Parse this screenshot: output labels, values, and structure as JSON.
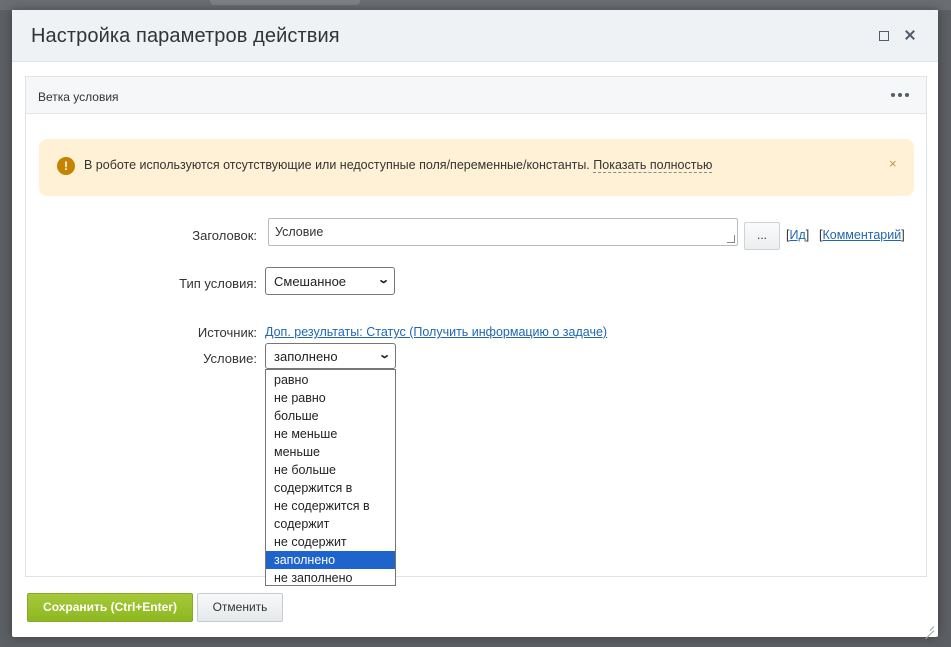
{
  "dialog": {
    "title": "Настройка параметров действия",
    "maximize_icon": "maximize-icon",
    "close_icon": "close-icon"
  },
  "panel": {
    "title": "Ветка условия",
    "more_icon": "more-dots-icon"
  },
  "alert": {
    "icon": "warning-icon",
    "icon_glyph": "!",
    "message": "В роботе используются отсутствующие или недоступные поля/переменные/константы.",
    "link_text": "Показать полностью",
    "close_glyph": "×"
  },
  "form": {
    "title_label": "Заголовок:",
    "title_value": "Условие",
    "dots_button": "...",
    "id_link": "Ид",
    "comment_link": "Комментарий",
    "condition_type_label": "Тип условия:",
    "condition_type_value": "Смешанное",
    "source_label": "Источник:",
    "source_value": "Доп. результаты: Статус (Получить информацию о задаче)",
    "condition_label": "Условие:",
    "condition_value": "заполнено",
    "condition_options": [
      "равно",
      "не равно",
      "больше",
      "не меньше",
      "меньше",
      "не больше",
      "содержится в",
      "не содержится в",
      "содержит",
      "не содержит",
      "заполнено",
      "не заполнено"
    ],
    "selected_option_index": 10
  },
  "footer": {
    "save_label": "Сохранить (Ctrl+Enter)",
    "cancel_label": "Отменить"
  },
  "colors": {
    "accent_green": "#8db820",
    "link_blue": "#2067b0",
    "selection_blue": "#1f63cc",
    "alert_bg": "#fff1d6",
    "warning": "#c48300"
  }
}
